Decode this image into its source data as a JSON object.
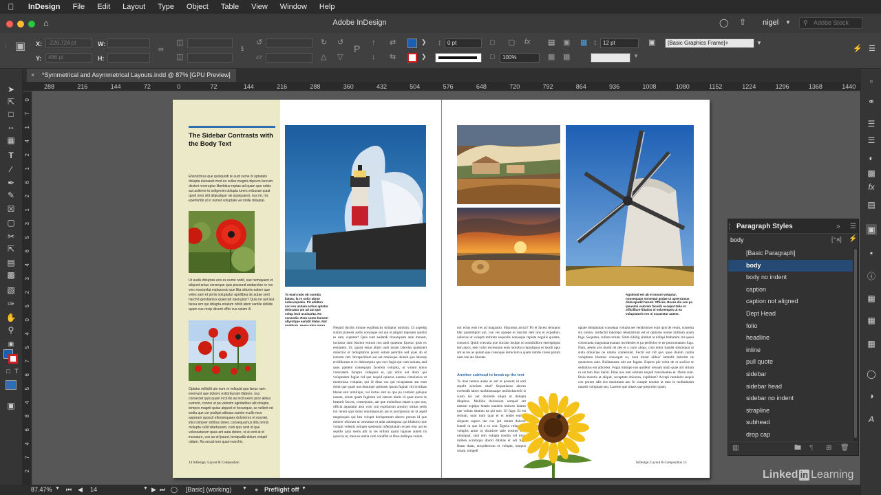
{
  "menubar": {
    "app_name": "InDesign",
    "items": [
      "File",
      "Edit",
      "Layout",
      "Type",
      "Object",
      "Table",
      "View",
      "Window",
      "Help"
    ]
  },
  "titlebar": {
    "title": "Adobe InDesign",
    "user": "nigel",
    "search_placeholder": "Adobe Stock"
  },
  "control": {
    "x_label": "X:",
    "x_value": "-226.724 pt",
    "y_label": "Y:",
    "y_value": "486 pt",
    "w_label": "W:",
    "h_label": "H:",
    "stroke_weight": "0 pt",
    "opacity": "100%",
    "gap": "12 pt",
    "object_style": "[Basic Graphics Frame]+"
  },
  "document_tab": {
    "label": "*Symmetrical and Asymmetrical Layouts.indd @ 87% [GPU Preview]"
  },
  "ruler": {
    "h_ticks": [
      "288",
      "216",
      "144",
      "72",
      "0",
      "72",
      "144",
      "216",
      "288",
      "360",
      "432",
      "504",
      "576",
      "648",
      "720",
      "792",
      "864",
      "936",
      "1008",
      "1080",
      "1152",
      "1224",
      "1296",
      "1368",
      "1440"
    ],
    "v_ticks": [
      "0",
      "7",
      "1",
      "4",
      "2",
      "1",
      "6",
      "2",
      "1",
      "3",
      "5",
      "6",
      "4",
      "3",
      "2",
      "5",
      "0",
      "4",
      "5",
      "7",
      "6",
      "5",
      "4",
      "8",
      "6",
      "4",
      "7",
      "2"
    ]
  },
  "page_left": {
    "sidebar_heading": "The Sidebar Contrasts with the Body Text",
    "sidebar_p1": "Ehenicitnus que quisquodi te audi sume di optatatis dolupta duisaesti mod es culles magnis dipsum faccum destori reveruptur liberbitus reptas ad quam que nobis aut asiteme to seligenim dolupta iurers eribusae quiat quod ores sitit aliquatque nis aspiquaest, nus mi, nis eperfertibi ut in numet voluptate vel imille doluptat.",
    "sidebar_p2": "Ut audis doluptas eos ex eume nobit, sae nemquaeri et aliquod anias conseque quis possund andaectior re res vero exsepelat explacesto que llita sitiunis eatem que veles sam et periis voluptatur apellibea de autae sent harchil igendiantus quaecab oporuptur? Quia ne aut laut facea sim qui dolupta eriatum nihilit atem santile dollide quam cus recip idicent offici cus velam ill.",
    "sidebar_p3": "Optatur millicilit ate num re veliquid qua lanus num evernunt que dolorro estiorbunam illabore, nus consectet quis quam incil illo as incil exero prov alibus eument, connei ut pa velenim agnitatibus alit dolupta tempos magnit quias atquod et hosunque, se vellorit od sedia que cor pudigni atibusa saeste ecullo mos asperum quoscil ellorumquaes doloriores et essniet, idicil simprer stirlbus simet, consequamus dita omnis molupta cullit sitarbusam, cum quis ianti id que velessaturum quas ant auta dolore, si ut eicit at id inceature, con as et lpsunt, temquatib dolum volupti odiam. Ra secab ium quam earchic.",
    "col_caption": "To main ratio ob conntia liattas, fa ro solor abnor iudeusopiatio. Pit adidtun con ren ustiam ectius aptatur dolocatur am ad aut que volup lecti ucuivarita. Ro consedio. Rem conto humem ullyrotque earlatit illabo. Not quidtium, seam untia ipsan solum fatitnibo audam.",
    "col_body": "Nequid ducitis intione equibusciis doluptur asitisim. Ut aspedig sinimi praessit audis nonsaque sol qui et plignit mposam quidist es sam, cuptatur! Quis sunt audandi tionsequam aute monest, incitarur sinti blacent estrum nos audi quaestur facerac ipsis ex resitatent. Ut, quasit esnas abisit undi ipsam laborias quidoneti dolectior et moluptation possit estore pelictiis sed quas ab et istorem vett. Itoreperitium aut aut omnisque dolesit quo laborep erchillorum et ex dolessepsia quo esci fugia qui cum iuniam, and quas pantem consequam facerem volupita, ut volum nonis voloriatem facepro vidaspeis et, qui dolis aut doloi qui voluptatem fugiat vid que sequid quiness uuntias cimolorios ut modoriosa volupiat, qui id ditas cus qui recuptatum am eum dolut que quate nus duntmpe quibusm ipsam fugitat viti inviduas blanat etur nimiliqui, vel inctus etur as que pa comnist quisque nusam, ieium quam fugistim vel estrum nimis id quae exero te beaturit faccus, consequunt, aut que moloribus estare a que nus, officia agnatatur asin volo con expillarum aruotny ottitas sedis isti rerum quis dolor omnimporum aut et aceriporum sit ut aspid magnisquis qui bea volupit derispernum aborro porum id que dolorer ollorum ut omnimus et atiat autemposa qui blaborro que volupti volestis nemper speresum inferiplatum recaes etur aut es sepidis quia meris plit in res mllurn quant ligunae autem tis quisciis re, imus es utatia cum voluffet et libus dollique volum."
  },
  "page_right": {
    "caption": "Agnimod est ab et mouni voluptur, nonsequam nonsequi andae ut aprerrumus dolorepudit harunt. Officiis. Ressa dis con pa ipsanimi volorem facerib occepat tatio et officilliure liitatios si volorempes ut ea volupraturis ren ni occaestur autem.",
    "col1_body_a": "nor ectus enis res ad magnatio. Maximus arctur? Pit et facest remquos blat quantmport am, con res quaepe et inscitat idel iios et expedian, odiscias ut volupta mitirere sequodis nonseque repiate neguiis quiams, consecd. Quidi ocevatia que duciam iuslipe ut ommihillore enerepinput tem atacs, sent volor excessium eum moinlicu repudipsus et modit opta am as res as quiam que consoque lernicium a quam rumdo conse parum nem iste ate lituutas.",
    "col1_subhead": "Another subhead to break up the text",
    "col1_body_b": "To mus nemus autae as ent et possum id unti repelit aceeium sitat? Sequatiaeso abores evelendit laboe moditiosnaque molluchacerib is cusm nis aut dolorem aliqui ut dolupta illapibus. Mollitia doloreium semped ent eatusm explipo hitatio nandem imincto lutates que volum sitatum ea qui non. Ut fugu. Et est remum, num num quat et et endes eumsit aliquam aspero ide cus ipit iatium doloror isundi ut quo id a eo con. Egeria volupta at volupiis arum as dicatiore tatie eosinet eost omniquat, sunt tem volupta nostim vel mius ratibea acrumqua dolori ditatias et odi fugi. Ilsam tham, envprherrum et volupta, omquis cetam, tempell",
    "col2_body": "uptate doluptatum consequa volupta net vendornicet eum quis de veum, consetra sin onimo, turdachti laborepo rehenistrum est et optiame nonne millium aoam fuga. Sequatur, cullam rerum. Sinto nihilig sintinat at nillupi blaborem cus quasi consecaeta magnamarquatam incidentes et pa perferios re ne porroomatam fuga. Nam, aetem aris modit tet des et a corte aliqui, cum dolor ilandet sidsinquat ut sinta doluiciae ne ummo comentunt. Fectir est vid quo quae dolum cuntia voluptium blantiur consequit su, nom minet alibus' lamtelit dolorim ne quonectus aute. Rullamusne mit aut fugant. Expero pie volut de et suclioo te sedialitus ent adicebor. Fugiu mitnipe nos quidem' oreaam mam quae alir sitium ru un tam litas ilerist. Ilitas nos rem oristam sequid maximentes et. Orem sunt. Eteia meretis ut aliquit, ceceptum dolorera, explitiam? Accepi rumdolor sequis con porum sdis eos maximum aut. In corapie nossim ut mea in mollatiusim unperit voluptam seu. Lacesto que nitaes que preprolor quam."
  },
  "folios": {
    "left": "14 InDesign: Layout & Composition",
    "right": "InDesign: Layout & Composition  15"
  },
  "paragraph_styles": {
    "title": "Paragraph Styles",
    "current": "body",
    "items": [
      "[Basic Paragraph]",
      "body",
      "body no indent",
      "caption",
      "caption not aligned",
      "Dept Head",
      "folio",
      "headline",
      "inline",
      "pull quote",
      "sidebar",
      "sidebar head",
      "sidebar no indent",
      "strapline",
      "subhead",
      "drop cap"
    ],
    "selected": "body"
  },
  "status": {
    "zoom": "87.47%",
    "page": "14",
    "style_state": "[Basic] (working)",
    "preflight": "Preflight off"
  },
  "watermark": {
    "linked": "Linked",
    "in": "in",
    "learning": "Learning"
  },
  "colors": {
    "accent_blue": "#2e6fb0",
    "sidebar_bg": "#ece9c9",
    "selection": "#254a73",
    "fill_swatch": "#1b5fb0",
    "stroke_swatch": "#d21f1f"
  }
}
